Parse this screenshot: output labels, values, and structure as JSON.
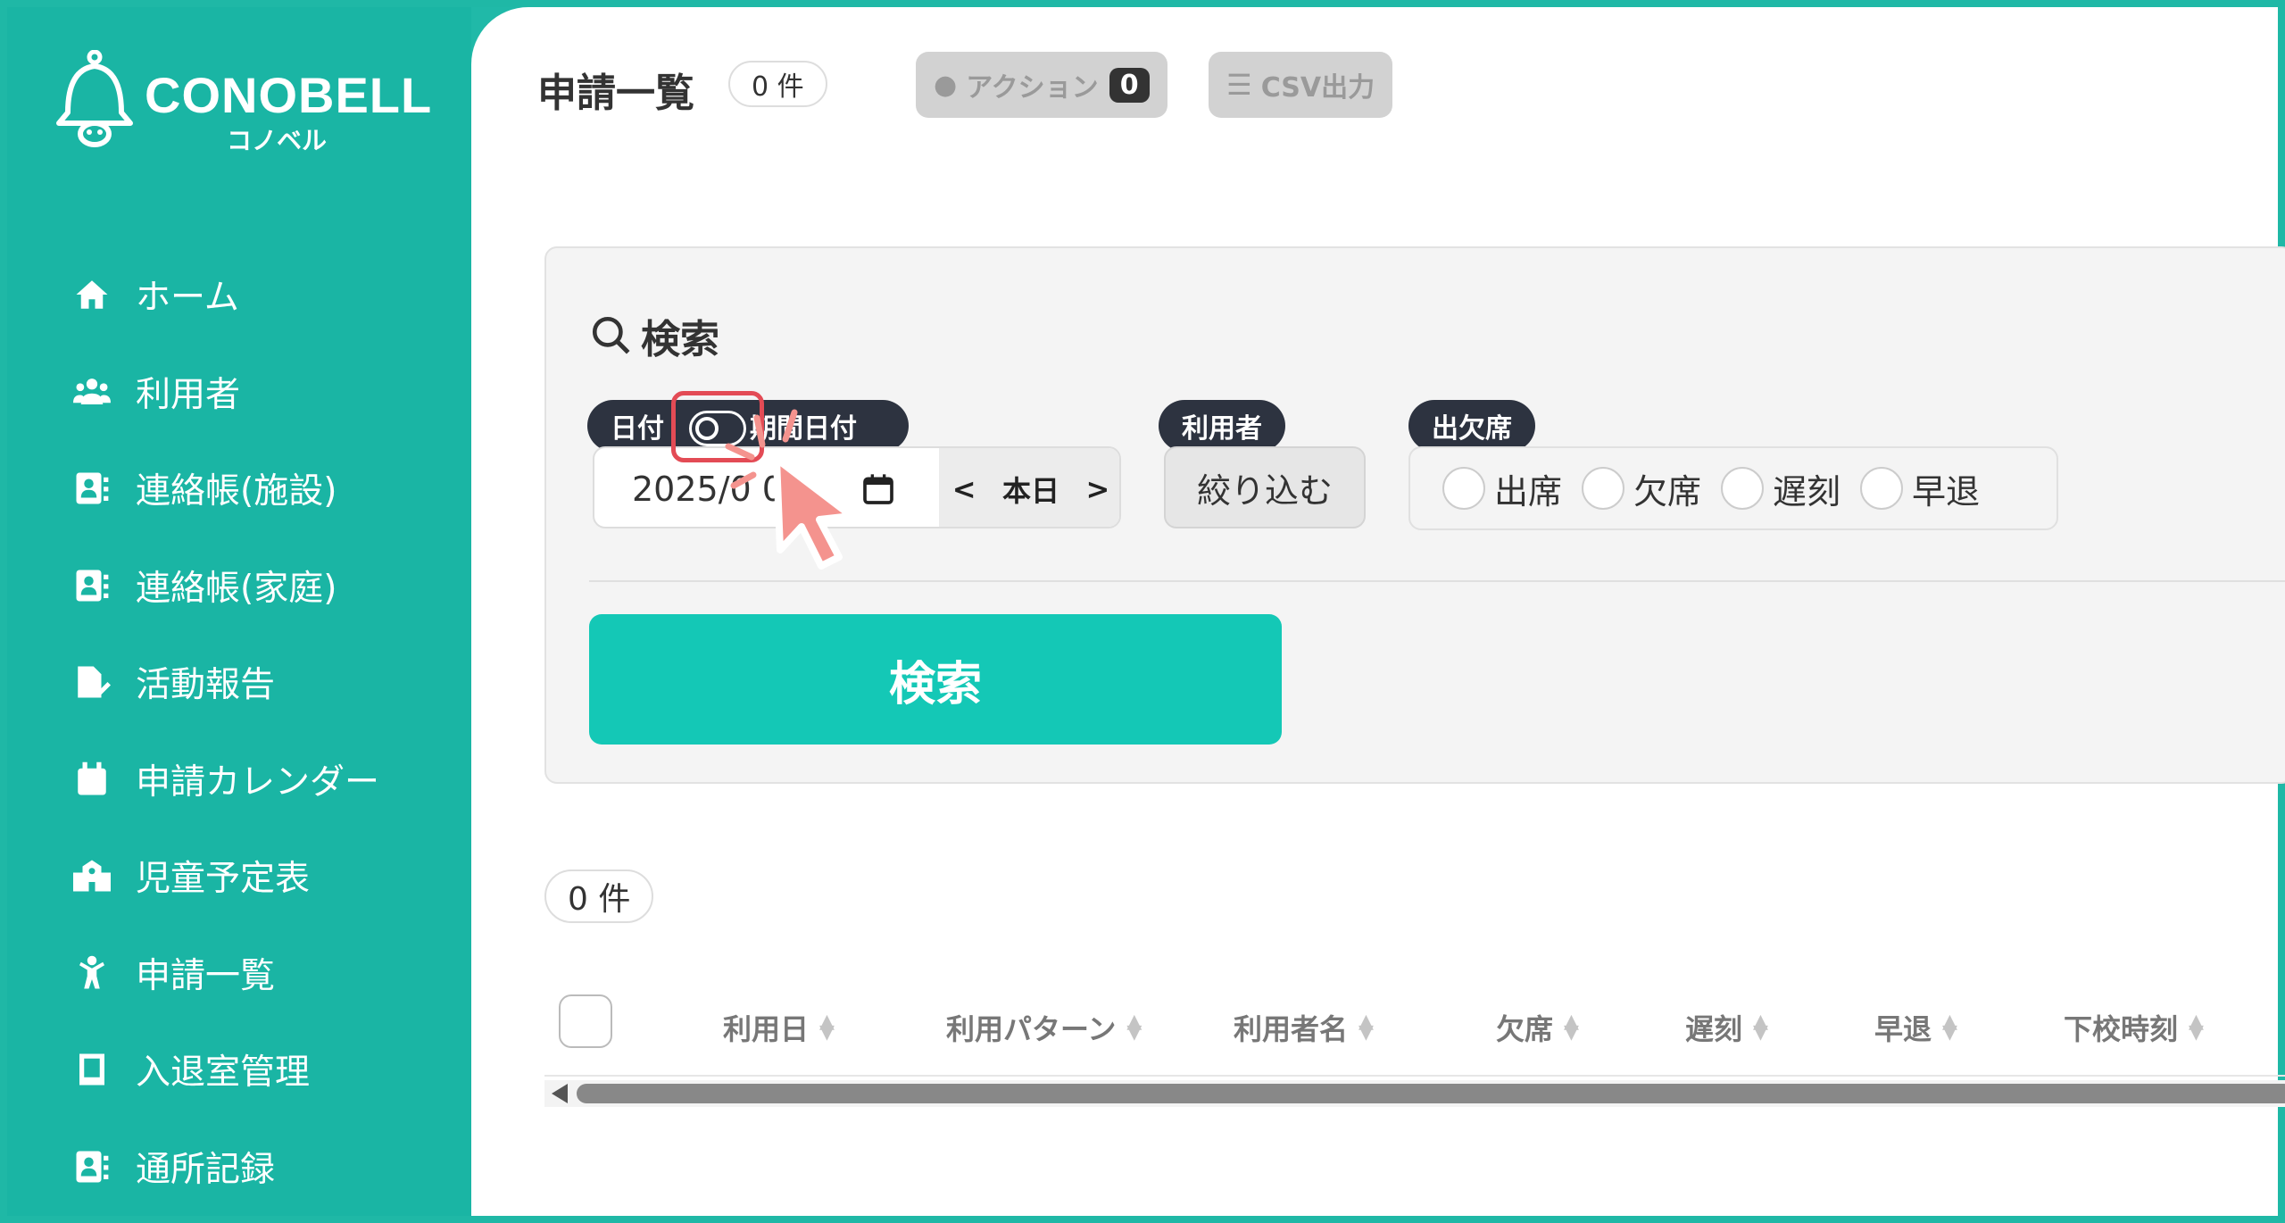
{
  "brand": {
    "name": "CONOBELL",
    "sub": "コノベル"
  },
  "sidebar": {
    "items": [
      {
        "label": "ホーム",
        "icon": "home-icon"
      },
      {
        "label": "利用者",
        "icon": "users-icon"
      },
      {
        "label": "連絡帳(施設)",
        "icon": "contact-book-icon"
      },
      {
        "label": "連絡帳(家庭)",
        "icon": "contact-book-icon"
      },
      {
        "label": "活動報告",
        "icon": "document-edit-icon"
      },
      {
        "label": "申請カレンダー",
        "icon": "calendar-icon"
      },
      {
        "label": "児童予定表",
        "icon": "school-icon"
      },
      {
        "label": "申請一覧",
        "icon": "child-icon"
      },
      {
        "label": "入退室管理",
        "icon": "tablet-icon"
      },
      {
        "label": "通所記録",
        "icon": "contact-book-icon"
      }
    ]
  },
  "header": {
    "title": "申請一覧",
    "count": "0 件",
    "action_label": "アクション",
    "action_badge": "0",
    "csv_label": "CSV出力"
  },
  "search": {
    "title": "検索",
    "date_tag": "日付",
    "period_tag": "期間日付",
    "date_value": "2025/0 0",
    "today_label": "本日",
    "user_tag": "利用者",
    "filter_button": "絞り込む",
    "attendance_tag": "出欠席",
    "attendance_options": [
      "出席",
      "欠席",
      "遅刻",
      "早退"
    ],
    "submit_label": "検索"
  },
  "results": {
    "count": "0 件",
    "columns": [
      "利用日",
      "利用パターン",
      "利用者名",
      "欠席",
      "遅刻",
      "早退",
      "下校時刻"
    ]
  },
  "colors": {
    "brand_teal": "#1ab5a4",
    "search_button": "#14c8b6",
    "tag_dark": "#2d3340",
    "highlight_red": "#e34b55",
    "cursor_pink": "#f4938e"
  }
}
